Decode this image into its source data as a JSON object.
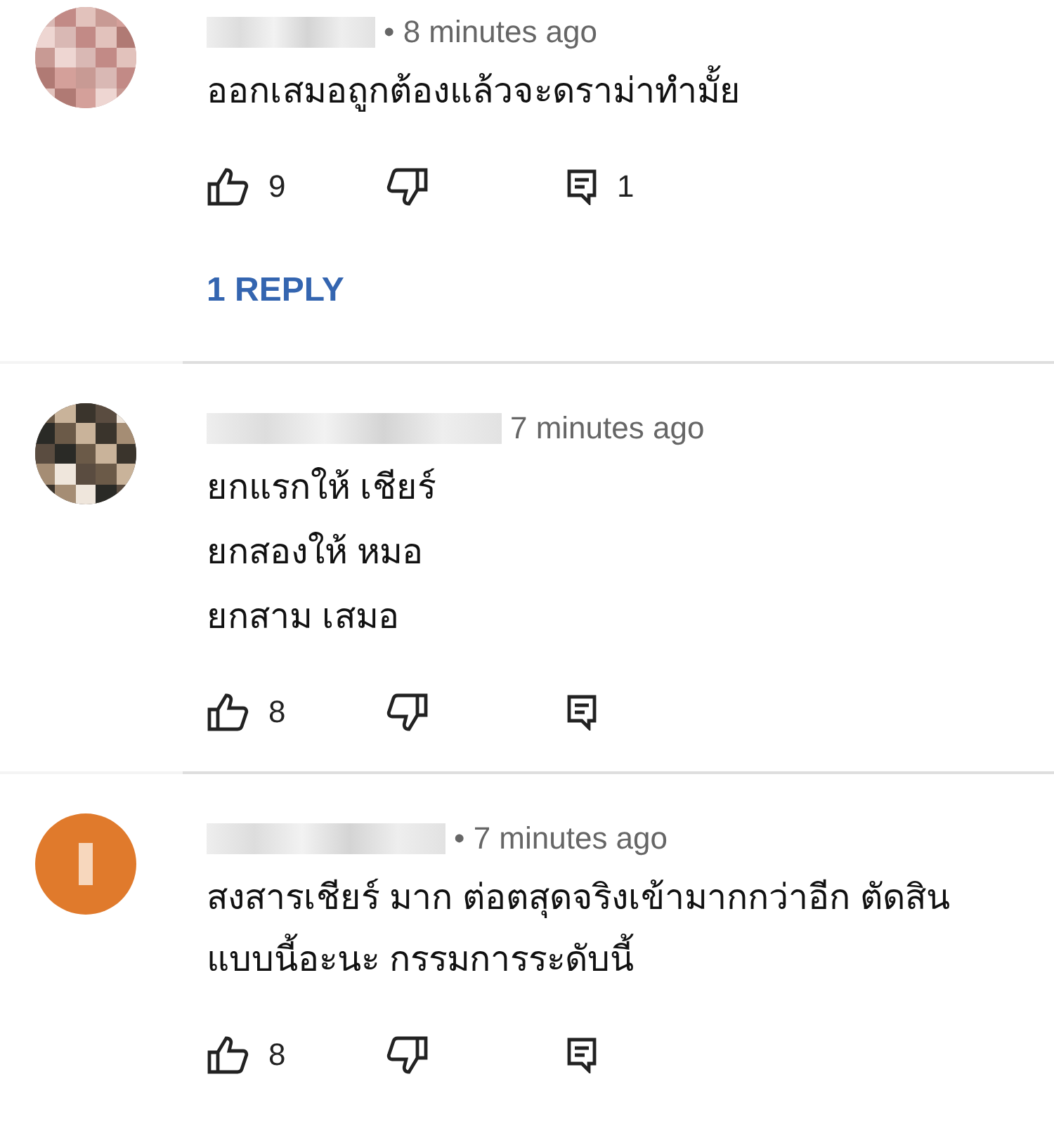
{
  "comments": [
    {
      "avatar": {
        "kind": "mosaic",
        "color": "#c89a94"
      },
      "time": "• 8 minutes ago",
      "text": [
        "ออกเสมอถูกต้องแล้วจะดราม่าทำมั้ย"
      ],
      "likes": "9",
      "reply_count": "1",
      "replies_link": "1 REPLY"
    },
    {
      "avatar": {
        "kind": "mosaic",
        "color": "#5a4c40"
      },
      "time": "7 minutes ago",
      "text": [
        "ยกแรกให้ เชียร์",
        "ยกสองให้ หมอ",
        "ยกสาม เสมอ"
      ],
      "likes": "8"
    },
    {
      "avatar": {
        "kind": "initial",
        "color": "#e07a2c"
      },
      "time": "• 7 minutes ago",
      "text": [
        "สงสารเชียร์ มาก ต่อตสุดจริงเข้ามากกว่าอีก ตัดสิน แบบนี้อะนะ กรรมการระดับนี้"
      ],
      "likes": "8"
    }
  ]
}
